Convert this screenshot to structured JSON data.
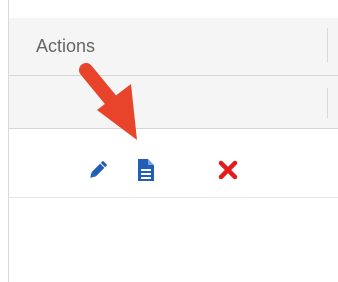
{
  "grid": {
    "header": {
      "actions_label": "Actions"
    },
    "row_actions": [
      {
        "name": "edit",
        "icon": "pencil-icon",
        "color": "#1f5fb8"
      },
      {
        "name": "view",
        "icon": "document-icon",
        "color": "#1f5fb8"
      },
      {
        "name": "delete",
        "icon": "close-icon",
        "color": "#e31b1b"
      }
    ]
  },
  "annotation": {
    "icon": "arrow-icon",
    "color": "#e8432b"
  }
}
